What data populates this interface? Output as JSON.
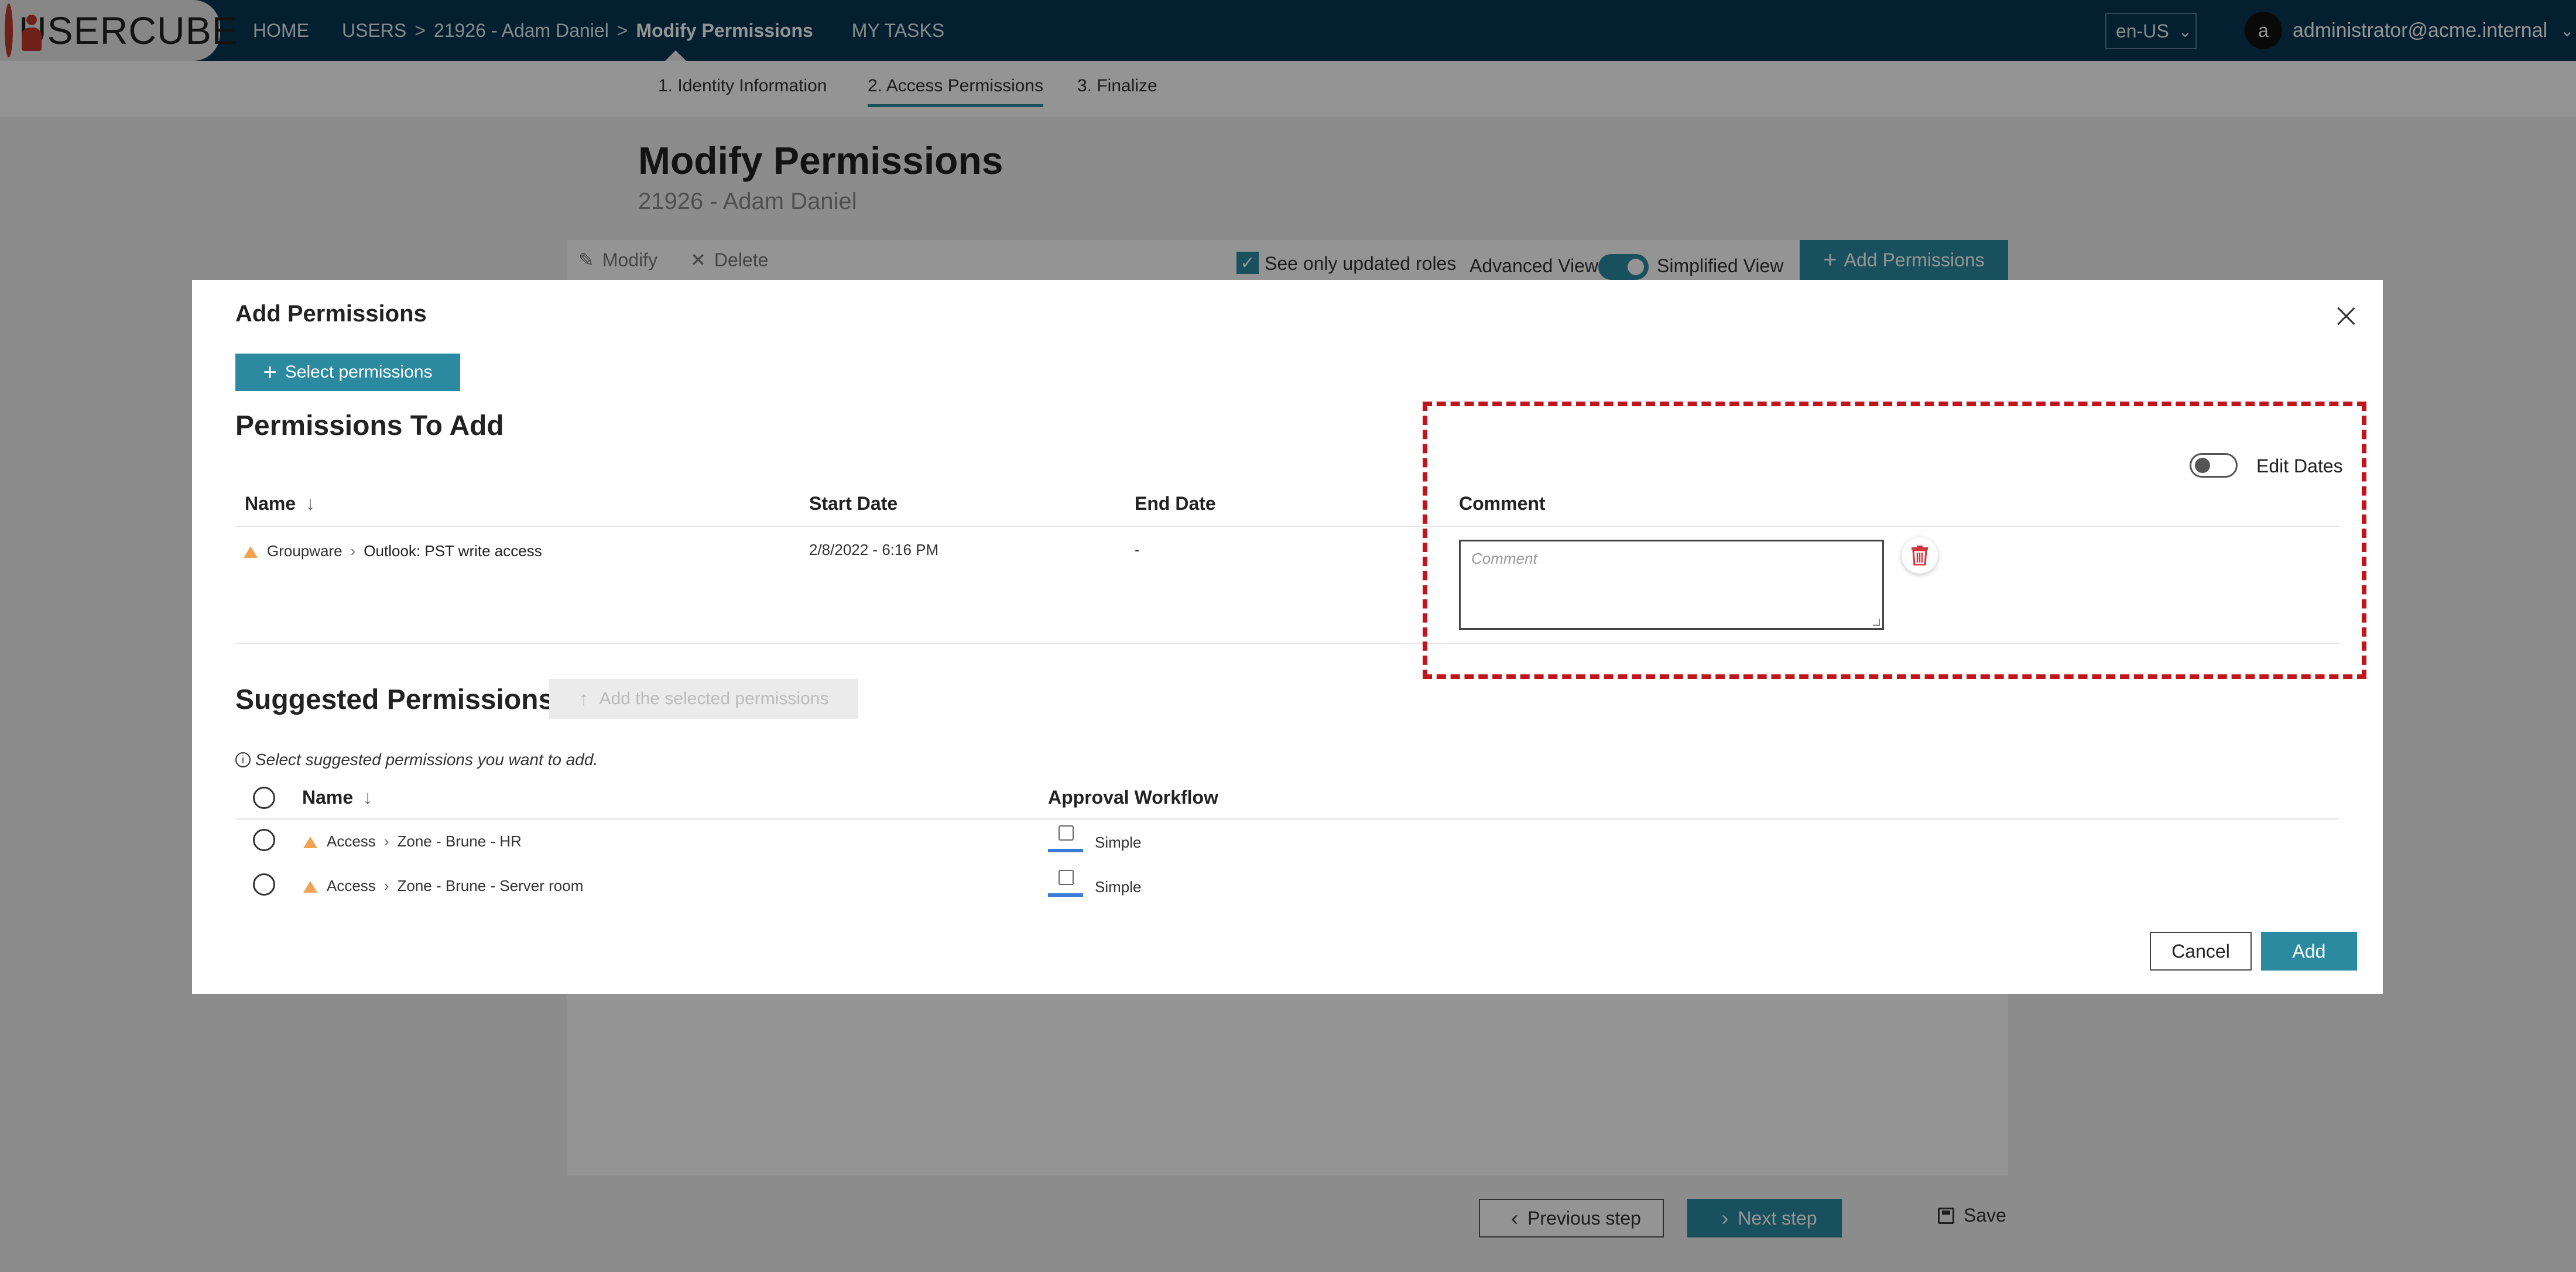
{
  "header": {
    "brand": "USERCUBE",
    "nav": {
      "home": "HOME",
      "users": "USERS",
      "user": "21926 - Adam Daniel",
      "current": "Modify Permissions",
      "tasks": "MY TASKS"
    },
    "language": "en-US",
    "user": {
      "initial": "a",
      "email": "administrator@acme.internal"
    }
  },
  "stepper": {
    "steps": [
      "1. Identity Information",
      "2. Access Permissions",
      "3. Finalize"
    ],
    "active_index": 1
  },
  "page": {
    "title": "Modify Permissions",
    "subtitle": "21926 - Adam Daniel",
    "toolbar": {
      "modify": "Modify",
      "delete": "Delete",
      "see_only_updated": "See only updated roles",
      "see_only_updated_checked": true,
      "advanced_view": "Advanced View",
      "simplified_view": "Simplified View",
      "add_permissions": "Add Permissions"
    },
    "footer": {
      "previous": "Previous step",
      "next": "Next step",
      "save": "Save"
    }
  },
  "modal": {
    "title": "Add Permissions",
    "select_permissions": "Select permissions",
    "to_add": {
      "title": "Permissions To Add",
      "edit_dates": "Edit Dates",
      "edit_dates_on": false,
      "columns": {
        "name": "Name",
        "start": "Start Date",
        "end": "End Date",
        "comment": "Comment"
      },
      "rows": [
        {
          "category": "Groupware",
          "name": "Outlook: PST write access",
          "start": "2/8/2022  - 6:16 PM",
          "end": "-",
          "comment_placeholder": "Comment"
        }
      ]
    },
    "suggested": {
      "title": "Suggested Permissions",
      "add_selected": "Add the selected permissions",
      "info": "Select suggested permissions you want to add.",
      "columns": {
        "name": "Name",
        "workflow": "Approval Workflow"
      },
      "rows": [
        {
          "category": "Access",
          "name": "Zone - Brune - HR",
          "workflow": "Simple"
        },
        {
          "category": "Access",
          "name": "Zone - Brune - Server room",
          "workflow": "Simple"
        }
      ]
    },
    "cancel": "Cancel",
    "add": "Add"
  }
}
